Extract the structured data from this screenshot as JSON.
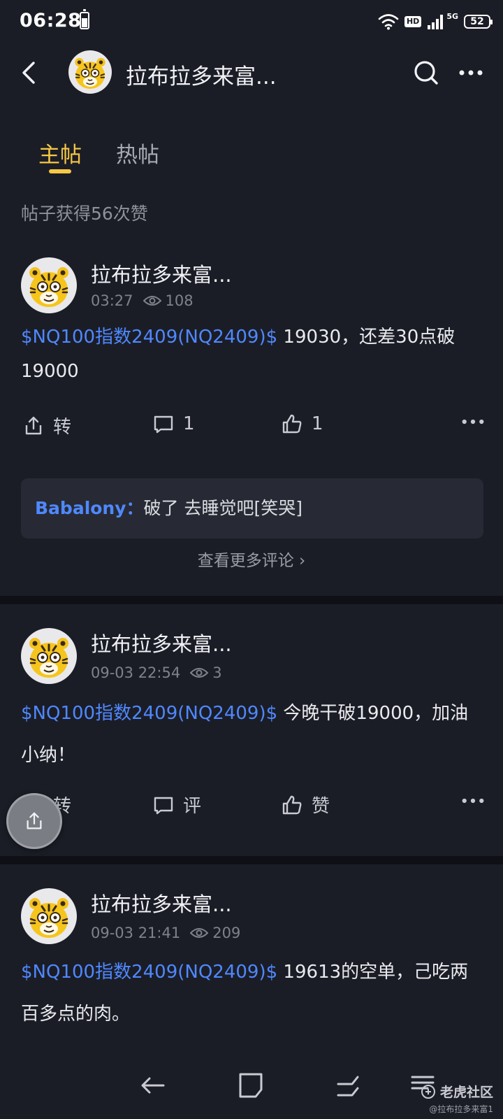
{
  "status": {
    "time": "06:28",
    "hd": "HD",
    "network": "5G",
    "battery": "52"
  },
  "header": {
    "title": "拉布拉多来富..."
  },
  "tabs": [
    {
      "label": "主帖"
    },
    {
      "label": "热帖"
    }
  ],
  "likes_summary": "帖子获得56次赞",
  "posts": [
    {
      "author": "拉布拉多来富...",
      "time": "03:27",
      "views": "108",
      "ticker": "$NQ100指数2409(NQ2409)$",
      "text": " 19030，还差30点破19000",
      "share_label": "转",
      "comment_count": "1",
      "like_count": "1",
      "comment": {
        "user": "Babalony：",
        "text": "破了 去睡觉吧[笑哭]"
      },
      "more_comments": "查看更多评论 ›"
    },
    {
      "author": "拉布拉多来富...",
      "time": "09-03 22:54",
      "views": "3",
      "ticker": "$NQ100指数2409(NQ2409)$",
      "text": " 今晚干破19000，加油小纳！",
      "share_label": "转",
      "comment_label": "评",
      "like_label": "赞"
    },
    {
      "author": "拉布拉多来富...",
      "time": "09-03 21:41",
      "views": "209",
      "ticker": "$NQ100指数2409(NQ2409)$",
      "text": " 19613的空单，己吃两百多点的肉。"
    }
  ],
  "watermark": {
    "brand": "老虎社区",
    "handle": "@拉布拉多来富1"
  },
  "colors": {
    "background": "#1b1d26",
    "accent": "#f7c844",
    "link": "#4f88ff"
  },
  "icons": [
    "back-arrow-icon",
    "search-icon",
    "more-dots-icon",
    "eye-icon",
    "share-icon",
    "comment-icon",
    "thumbs-up-icon",
    "tiger-avatar-icon"
  ]
}
